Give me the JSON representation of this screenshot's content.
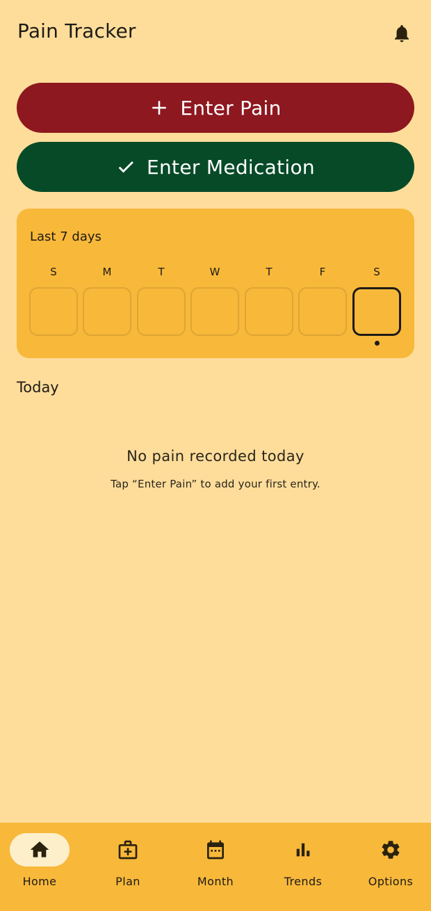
{
  "app_bar": {
    "title": "Pain Tracker",
    "notification_icon": "bell-icon"
  },
  "actions": {
    "enter_pain": {
      "label": "Enter Pain",
      "icon": "plus-icon",
      "color": "#8E1820"
    },
    "enter_medication": {
      "label": "Enter Medication",
      "icon": "check-icon",
      "color": "#074A28"
    }
  },
  "week": {
    "title": "Last 7 days",
    "days": [
      "S",
      "M",
      "T",
      "W",
      "T",
      "F",
      "S"
    ],
    "selected_index": 6
  },
  "today": {
    "heading": "Today",
    "empty_title": "No pain recorded today",
    "empty_subtitle": "Tap “Enter Pain” to add your first entry."
  },
  "nav": {
    "items": [
      {
        "label": "Home",
        "icon": "home-icon",
        "active": true
      },
      {
        "label": "Plan",
        "icon": "medical-bag-icon",
        "active": false
      },
      {
        "label": "Month",
        "icon": "calendar-icon",
        "active": false
      },
      {
        "label": "Trends",
        "icon": "bar-chart-icon",
        "active": false
      },
      {
        "label": "Options",
        "icon": "gear-icon",
        "active": false
      }
    ]
  },
  "colors": {
    "background": "#FEDD9A",
    "card": "#F8B83A",
    "nav_active_pill": "#FEEFCB"
  }
}
